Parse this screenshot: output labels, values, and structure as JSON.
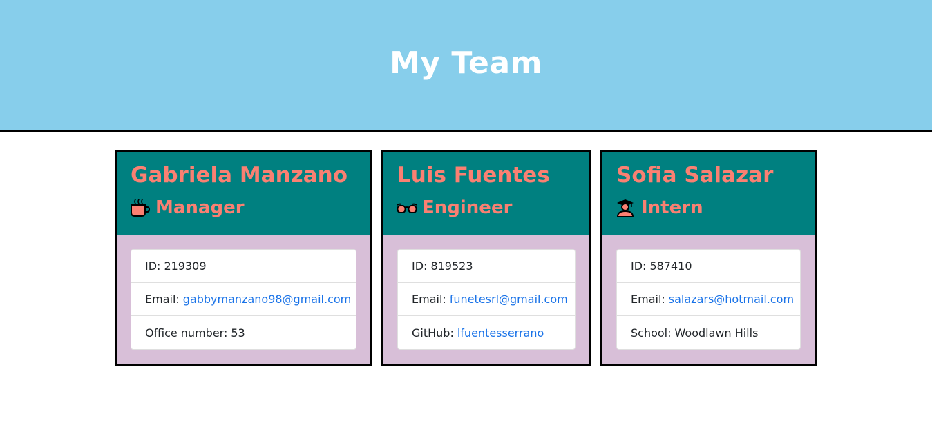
{
  "page": {
    "title": "My Team"
  },
  "colors": {
    "header_bg": "#87ceeb",
    "card_head_bg": "#008080",
    "card_body_bg": "#d8bfd8",
    "name_color": "#fa8072",
    "link_color": "#1a73e8"
  },
  "cards": [
    {
      "name": "Gabriela Manzano",
      "role": "Manager",
      "role_icon": "coffee-mug-icon",
      "id_label": "ID:",
      "id_value": "219309",
      "email_label": "Email:",
      "email_value": "gabbymanzano98@gmail.com",
      "extra_label": "Office number:",
      "extra_value": "53"
    },
    {
      "name": "Luis Fuentes",
      "role": "Engineer",
      "role_icon": "glasses-icon",
      "id_label": "ID:",
      "id_value": "819523",
      "email_label": "Email:",
      "email_value": "funetesrl@gmail.com",
      "extra_label": "GitHub:",
      "extra_value": "lfuentesserrano"
    },
    {
      "name": "Sofia Salazar",
      "role": "Intern",
      "role_icon": "graduate-icon",
      "id_label": "ID:",
      "id_value": "587410",
      "email_label": "Email:",
      "email_value": "salazars@hotmail.com",
      "extra_label": "School:",
      "extra_value": "Woodlawn Hills"
    }
  ]
}
